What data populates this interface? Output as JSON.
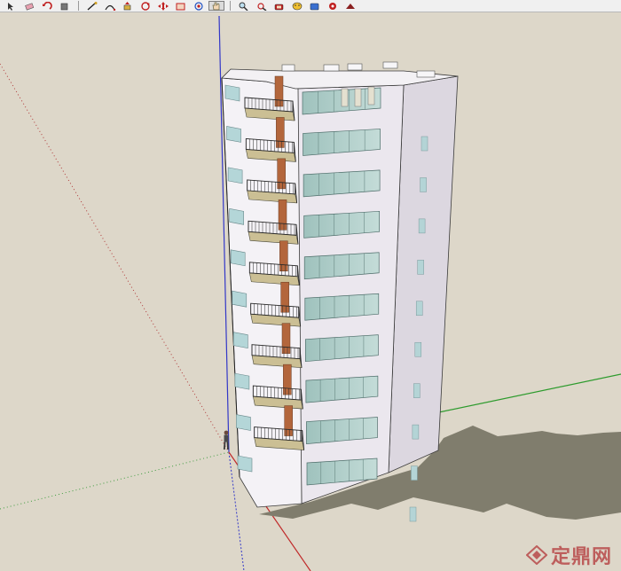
{
  "toolbar": {
    "tools": [
      {
        "icon": "select-arrow-icon"
      },
      {
        "icon": "eraser-icon"
      },
      {
        "icon": "undo-icon"
      },
      {
        "icon": "paint-bucket-icon"
      },
      {
        "icon": "line-pencil-icon"
      },
      {
        "icon": "arc-icon"
      },
      {
        "icon": "push-pull-icon"
      },
      {
        "icon": "rotate-icon"
      },
      {
        "icon": "move-icon"
      },
      {
        "icon": "scale-icon"
      },
      {
        "icon": "orbit-icon"
      },
      {
        "icon": "pan-hand-icon"
      },
      {
        "icon": "zoom-icon"
      },
      {
        "icon": "zoom-extents-icon"
      },
      {
        "icon": "tape-measure-icon"
      },
      {
        "icon": "section-plane-icon"
      },
      {
        "icon": "walk-icon"
      },
      {
        "icon": "position-camera-icon"
      },
      {
        "icon": "look-around-icon"
      }
    ],
    "active_tool": "pan-hand-icon"
  },
  "scene": {
    "floors": 9,
    "sky_color": "#ddd7c9",
    "shadow_color": "#807d6d",
    "facade_color": "#ebe7ee",
    "glass_color": "#a4c4c0"
  },
  "watermark": {
    "logo_icon": "zhulong-diamond-logo-icon",
    "text": "定鼎网"
  }
}
